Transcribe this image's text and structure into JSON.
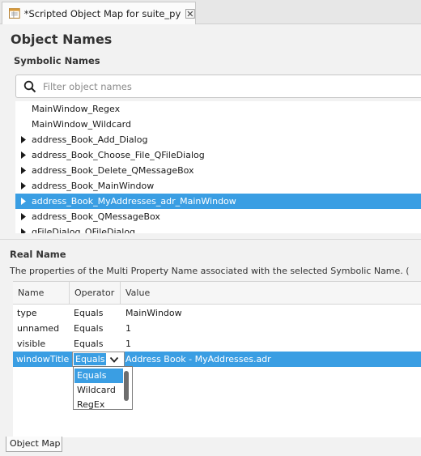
{
  "editor_tab": {
    "title": "*Scripted Object Map for suite_py"
  },
  "page_title": "Object Names",
  "symbolic": {
    "heading": "Symbolic Names",
    "search_placeholder": "Filter object names",
    "items": [
      {
        "label": "MainWindow_Regex",
        "expandable": false,
        "selected": false
      },
      {
        "label": "MainWindow_Wildcard",
        "expandable": false,
        "selected": false
      },
      {
        "label": "address_Book_Add_Dialog",
        "expandable": true,
        "selected": false
      },
      {
        "label": "address_Book_Choose_File_QFileDialog",
        "expandable": true,
        "selected": false
      },
      {
        "label": "address_Book_Delete_QMessageBox",
        "expandable": true,
        "selected": false
      },
      {
        "label": "address_Book_MainWindow",
        "expandable": true,
        "selected": false
      },
      {
        "label": "address_Book_MyAddresses_adr_MainWindow",
        "expandable": true,
        "selected": true
      },
      {
        "label": "address_Book_QMessageBox",
        "expandable": true,
        "selected": false
      },
      {
        "label": "qFileDialog_QFileDialog",
        "expandable": true,
        "selected": false
      }
    ]
  },
  "real_name": {
    "heading": "Real Name",
    "description": "The properties of the Multi Property Name associated with the selected Symbolic Name. (",
    "columns": [
      "Name",
      "Operator",
      "Value"
    ],
    "rows": [
      {
        "name": "type",
        "operator": "Equals",
        "value": "MainWindow"
      },
      {
        "name": "unnamed",
        "operator": "Equals",
        "value": "1"
      },
      {
        "name": "visible",
        "operator": "Equals",
        "value": "1"
      },
      {
        "name": "windowTitle",
        "operator": "Equals",
        "value": "Address Book - MyAddresses.adr"
      }
    ],
    "operator_options": [
      "Equals",
      "Wildcard",
      "RegEx"
    ]
  },
  "bottom_tab": {
    "label": "Object Map"
  },
  "colors": {
    "selection": "#3a9ee3",
    "panel_bg": "#f2f2f2"
  }
}
